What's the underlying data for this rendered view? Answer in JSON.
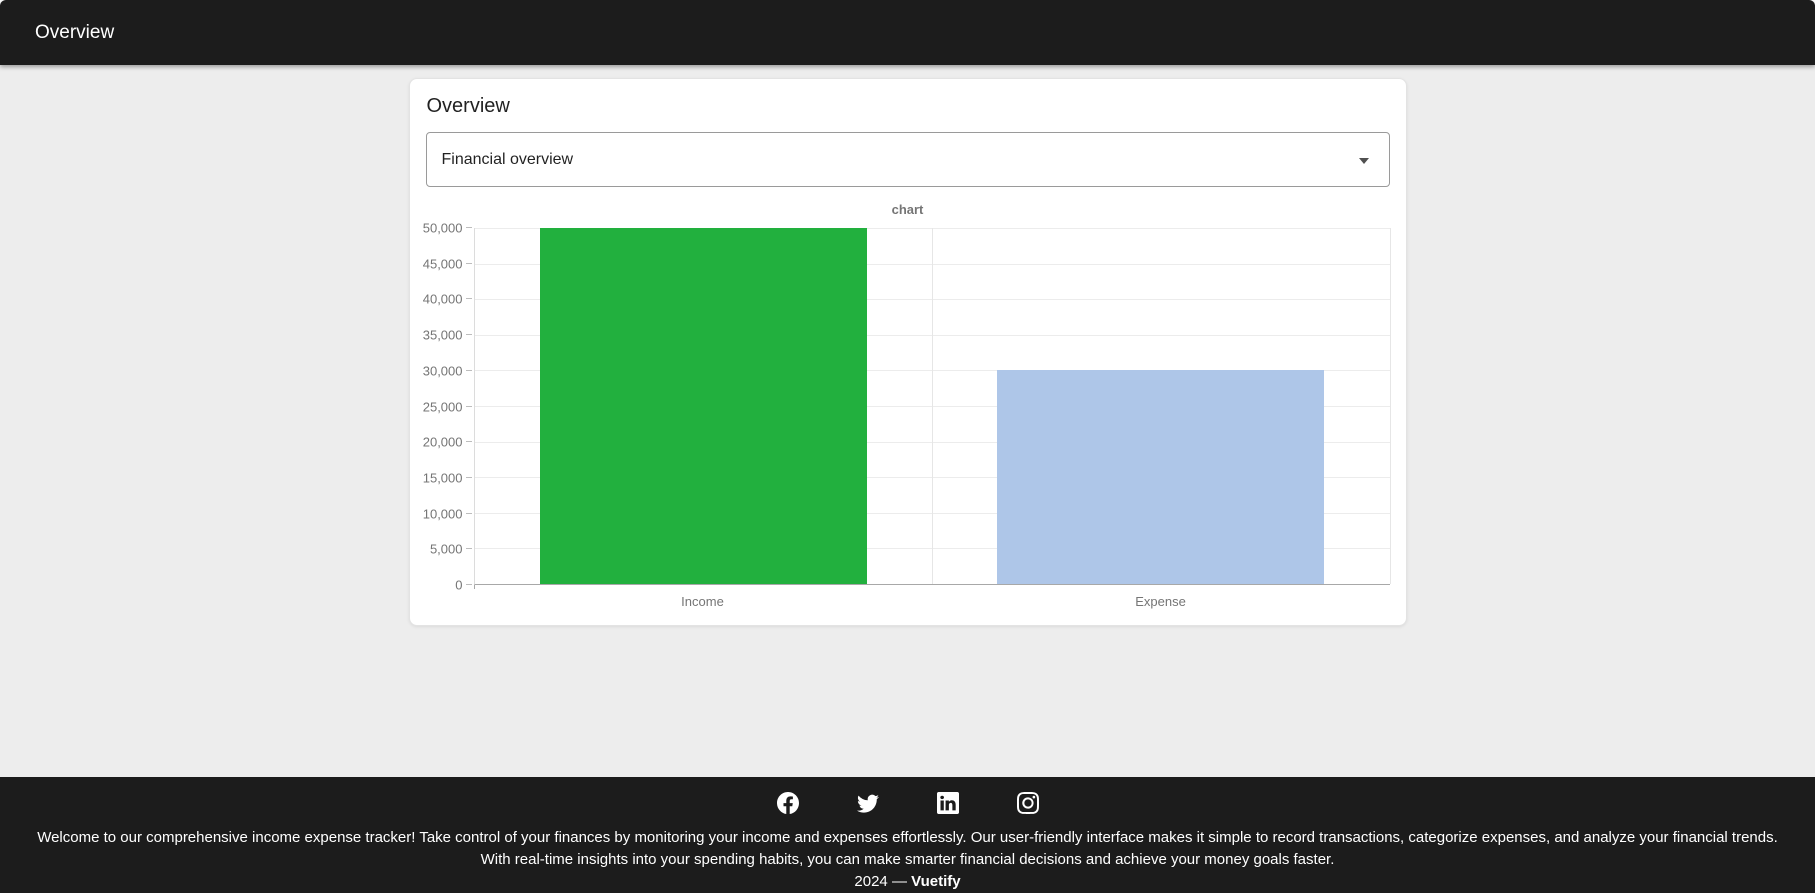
{
  "app_bar": {
    "title": "Overview"
  },
  "card": {
    "title": "Overview",
    "select": {
      "value": "Financial overview"
    }
  },
  "chart_data": {
    "type": "bar",
    "title": "chart",
    "categories": [
      "Income",
      "Expense"
    ],
    "values": [
      50000,
      30000
    ],
    "bar_colors": [
      "#22b03e",
      "#aec6e8"
    ],
    "xlabel": "",
    "ylabel": "",
    "ylim": [
      0,
      50000
    ],
    "ytick_step": 5000,
    "ytick_labels": [
      "0",
      "5,000",
      "10,000",
      "15,000",
      "20,000",
      "25,000",
      "30,000",
      "35,000",
      "40,000",
      "45,000",
      "50,000"
    ],
    "grid": true,
    "legend": "none"
  },
  "footer": {
    "social_links": [
      {
        "name": "facebook"
      },
      {
        "name": "twitter"
      },
      {
        "name": "linkedin"
      },
      {
        "name": "instagram"
      }
    ],
    "description": "Welcome to our comprehensive income expense tracker! Take control of your finances by monitoring your income and expenses effortlessly. Our user-friendly interface makes it simple to record transactions, categorize expenses, and analyze your financial trends. With real-time insights into your spending habits, you can make smarter financial decisions and achieve your money goals faster.",
    "copyright_prefix": "2024 — ",
    "brand": "Vuetify"
  },
  "colors": {
    "app_bar_bg": "#1c1c1c",
    "footer_bg": "#1c1c1c",
    "page_bg": "#ededed",
    "income_bar": "#22b03e",
    "expense_bar": "#aec6e8"
  }
}
